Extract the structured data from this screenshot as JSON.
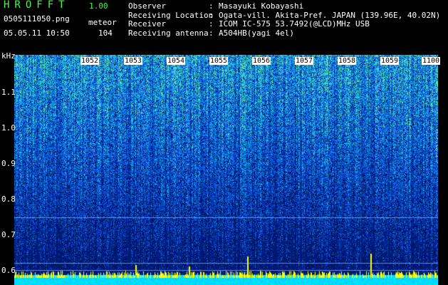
{
  "header": {
    "app_title": "HROFFT",
    "app_version": "1.00",
    "file_name": "0505111050.png",
    "mode": "meteor",
    "date_time": "05.05.11 10:50",
    "count": "104"
  },
  "info": [
    {
      "label": "Observer",
      "sep": ":",
      "value": "Masayuki Kobayashi"
    },
    {
      "label": "Receiving Location",
      "sep": ":",
      "value": "Ogata-vill. Akita-Pref. JAPAN (139.96E, 40.02N)"
    },
    {
      "label": "Receiver",
      "sep": ":",
      "value": "ICOM IC-575 53.7492(@LCD)MHz USB"
    },
    {
      "label": "Receiving antenna",
      "sep": ":",
      "value": "A504HB(yagi 4el)"
    }
  ],
  "plot": {
    "y_unit": "kHz",
    "y_ticks": [
      "1.1",
      "1.0",
      "0.9",
      "0.8",
      "0.7",
      "0.6"
    ],
    "time_labels": [
      "1052",
      "1053",
      "1054",
      "1055",
      "1056",
      "1057",
      "1058",
      "1059",
      "1100"
    ]
  },
  "colors": {
    "title_green": "#3cff3c",
    "label_white": "#ffffff",
    "background": "#000000",
    "spectrum_low": "#00005a",
    "spectrum_mid": "#1e64ff",
    "spectrum_high": "#3cffa0",
    "signal_yellow": "#ffff00",
    "baseline_cyan": "#00e6ff"
  }
}
